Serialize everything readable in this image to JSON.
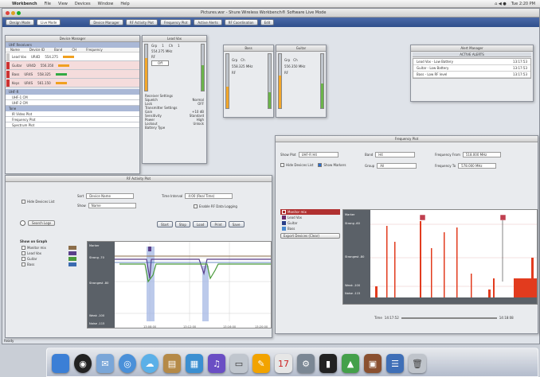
{
  "menubar": {
    "apple": "",
    "app": "Workbench",
    "items": [
      "File",
      "View",
      "Devices",
      "Window",
      "Help"
    ],
    "clock": "Tue 2:20 PM",
    "status": "⌂ ◀ ●"
  },
  "window": {
    "title": "Pictures.wsr - Shure Wireless Workbench® Software Live Mode",
    "statusbar": "Ready"
  },
  "toolbar": {
    "buttons": [
      "Design Mode",
      "Live Mode"
    ],
    "tabs": [
      "Device Manager",
      "RF Activity Plot",
      "Frequency Plot",
      "Active Alerts",
      "RF Coordination",
      "Edit"
    ]
  },
  "device_manager": {
    "title": "Device Manager",
    "group_a": "UHF Receivers",
    "group_b": "UHF-R",
    "group_c": "Tone",
    "headers": [
      "Name",
      "Device ID",
      "Band",
      "CH",
      "Frequency"
    ],
    "rows": [
      {
        "name": "Lead Vox",
        "id": "UR4D",
        "freq": "554.275"
      },
      {
        "name": "Guitar",
        "id": "UR4D",
        "freq": "556.350"
      },
      {
        "name": "Bass",
        "id": "UR4S",
        "freq": "558.325"
      },
      {
        "name": "Keys",
        "id": "UR4S",
        "freq": "561.150"
      }
    ],
    "extra_rows": [
      "UHF-1 CM",
      "UHF-2 CM",
      "IR Video Plot",
      "Frequency Plot",
      "Spectrum Plot"
    ]
  },
  "lead_vox": {
    "title": "Lead Vox",
    "group": "Grp",
    "channel": "Ch",
    "group_val": "1",
    "channel_val": "1",
    "freq": "554.275 MHz",
    "mode": "RF",
    "mute_label": "Off",
    "settings": [
      {
        "k": "Receiver Settings",
        "v": ""
      },
      {
        "k": "Squelch",
        "v": "Normal"
      },
      {
        "k": "Lock",
        "v": "OFF"
      },
      {
        "k": "Transmitter Settings",
        "v": ""
      },
      {
        "k": "Gain",
        "v": "+10 dB"
      },
      {
        "k": "Sensitivity",
        "v": "Standard"
      },
      {
        "k": "Power",
        "v": "High"
      },
      {
        "k": "Lockout",
        "v": "Unlock"
      },
      {
        "k": "Battery Type",
        "v": ""
      }
    ]
  },
  "bass": {
    "title": "Bass",
    "group": "Grp",
    "channel": "Ch",
    "freq": "558.325 MHz",
    "mode": "RF"
  },
  "guitar": {
    "title": "Guitar",
    "group": "Grp",
    "channel": "Ch",
    "freq": "556.350 MHz",
    "mode": "RF"
  },
  "alert_manager": {
    "title": "Alert Manager",
    "header": "ACTIVE ALERTS",
    "alerts": [
      {
        "text": "Lead Vox - Low Battery",
        "time": "13:17:53"
      },
      {
        "text": "Guitar - Low Battery",
        "time": "13:17:53"
      },
      {
        "text": "Bass - Low RF level",
        "time": "13:17:53"
      }
    ]
  },
  "rf_plot": {
    "title": "RF Activity Plot",
    "hide_unused": "Hide Devices List",
    "sort_label": "Sort",
    "sort_value": "Device Name",
    "show_label": "Show",
    "show_value": "Name",
    "time_interval": "Time Interval",
    "time_value": "4:00 (Real Time)",
    "enable_logging": "Enable RF Data Logging",
    "show_on_graph": "Show on Graph",
    "devices": [
      {
        "name": "Monitor mix",
        "color": "#8b6d4a"
      },
      {
        "name": "Lead Vox",
        "color": "#5a3f8a"
      },
      {
        "name": "Guitar",
        "color": "#4a9a3a"
      },
      {
        "name": "Bass",
        "color": "#3a6ab0"
      }
    ],
    "controls": [
      "Start",
      "Stop",
      "Load",
      "Print",
      "Save"
    ],
    "search_button": "Search Logs",
    "y_labels": [
      "Marker",
      "Strong -70",
      "",
      "Strongest -80",
      "",
      "Weak -100",
      "Noise -115"
    ],
    "x_labels": [
      "13:08:00",
      "13:12:00",
      "13:16:00",
      "13:20:00"
    ]
  },
  "freq_plot": {
    "title": "Frequency Plot",
    "show_plot": "Show Plot",
    "show_plot_val": "UHF-R H4",
    "band_label": "Band",
    "band_val": "H4",
    "group_label": "Group",
    "group_val": "All",
    "freq_from_label": "Frequency From",
    "freq_from_val": "518.000 MHz",
    "freq_to_label": "Frequency To",
    "freq_to_val": "578.000 MHz",
    "hide_devices": "Hide Devices List",
    "show_markers": "Show Markers",
    "devices": [
      {
        "name": "Monitor mix",
        "color": "#b03030"
      },
      {
        "name": "Lead Vox",
        "color": "#6b2b6b"
      },
      {
        "name": "Guitar",
        "color": "#2a3f8a"
      },
      {
        "name": "Bass",
        "color": "#4a8ad0"
      }
    ],
    "add_device": "Export Devices (Clear)",
    "y_labels": [
      "Marker",
      "Strong -60",
      "Strongest -80",
      "Weak -100",
      "Noise -115"
    ],
    "time_label": "Time",
    "time_val": "14:17:52",
    "end_time": "14:18:08"
  },
  "dock": {
    "icons": [
      "finder-icon",
      "safari-icon",
      "mail-icon",
      "itunes-icon",
      "ichat-icon",
      "iphoto-icon",
      "addressbook-icon",
      "preview-icon",
      "calendar-icon",
      "workbench-icon",
      "terminal-icon",
      "dashboard-icon",
      "trash-icon"
    ]
  }
}
